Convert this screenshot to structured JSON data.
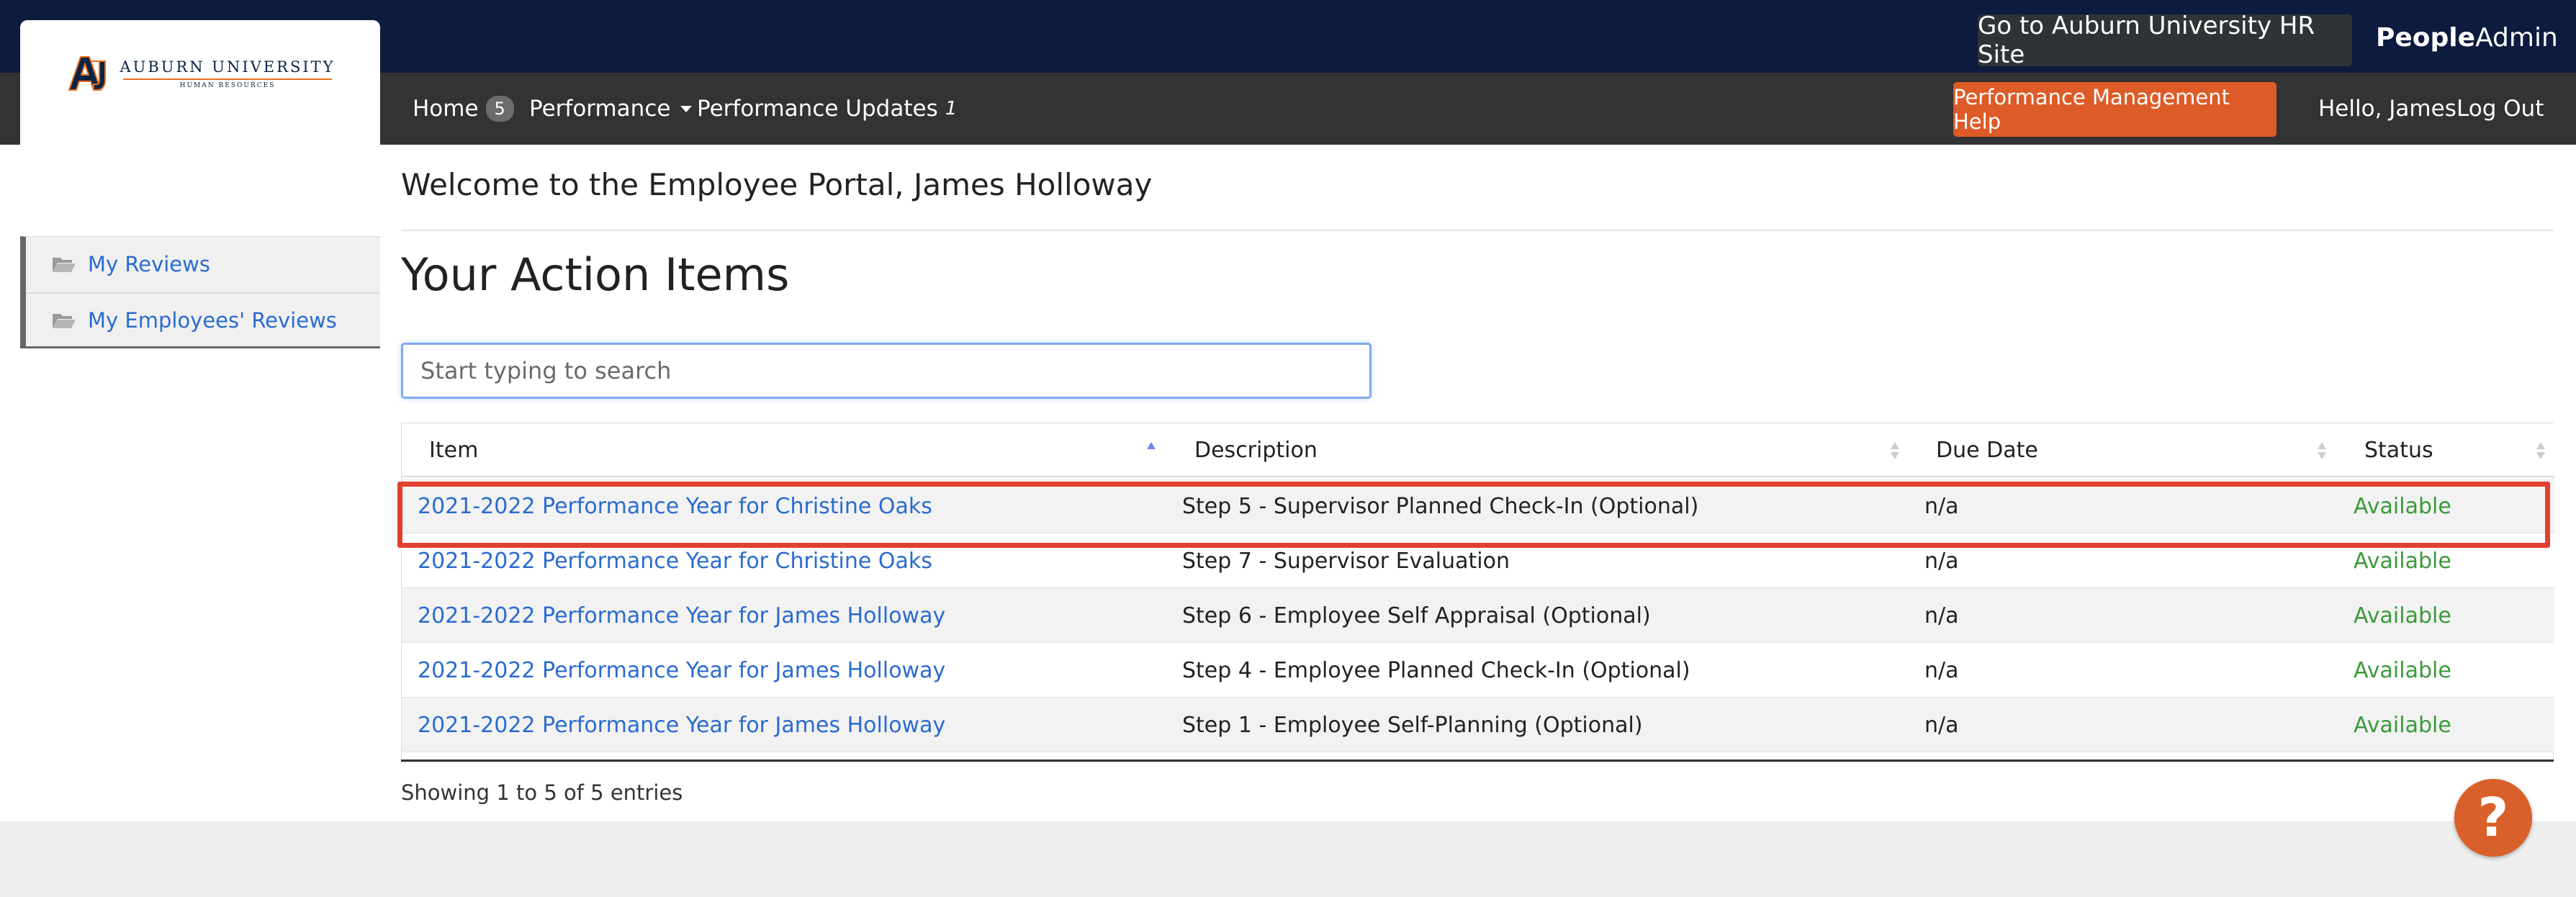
{
  "header": {
    "hr_site_button": "Go to Auburn University HR Site",
    "brand_bold": "People",
    "brand_regular": "Admin"
  },
  "logo": {
    "title": "AUBURN UNIVERSITY",
    "subtitle": "HUMAN RESOURCES"
  },
  "nav": {
    "home_label": "Home",
    "home_badge": "5",
    "performance_label": "Performance",
    "updates_label": "Performance Updates",
    "updates_count": "1",
    "help_button": "Performance Management Help",
    "greeting": "Hello, James",
    "logout": "Log Out"
  },
  "sidebar": {
    "items": [
      {
        "label": "My Reviews",
        "icon": "folder-open-icon"
      },
      {
        "label": "My Employees' Reviews",
        "icon": "folder-open-icon"
      }
    ]
  },
  "main": {
    "welcome": "Welcome to the Employee Portal, James Holloway",
    "title": "Your Action Items",
    "search_placeholder": "Start typing to search"
  },
  "table": {
    "headers": [
      "Item",
      "Description",
      "Due Date",
      "Status"
    ],
    "rows": [
      {
        "item": "2021-2022 Performance Year for Christine Oaks",
        "description": "Step 5 - Supervisor Planned Check-In (Optional)",
        "due": "n/a",
        "status": "Available"
      },
      {
        "item": "2021-2022 Performance Year for Christine Oaks",
        "description": "Step 7 - Supervisor Evaluation",
        "due": "n/a",
        "status": "Available"
      },
      {
        "item": "2021-2022 Performance Year for James Holloway",
        "description": "Step 6 - Employee Self Appraisal (Optional)",
        "due": "n/a",
        "status": "Available"
      },
      {
        "item": "2021-2022 Performance Year for James Holloway",
        "description": "Step 4 - Employee Planned Check-In (Optional)",
        "due": "n/a",
        "status": "Available"
      },
      {
        "item": "2021-2022 Performance Year for James Holloway",
        "description": "Step 1 - Employee Self-Planning (Optional)",
        "due": "n/a",
        "status": "Available"
      }
    ],
    "info": "Showing 1 to 5 of 5 entries"
  },
  "help_fab": "?",
  "colors": {
    "navy": "#0d1b3e",
    "nav_gray": "#333333",
    "accent_orange": "#dd5b27",
    "link_blue": "#2a6bd0",
    "status_green": "#3a9a3a",
    "highlight_red": "#e0402e"
  }
}
